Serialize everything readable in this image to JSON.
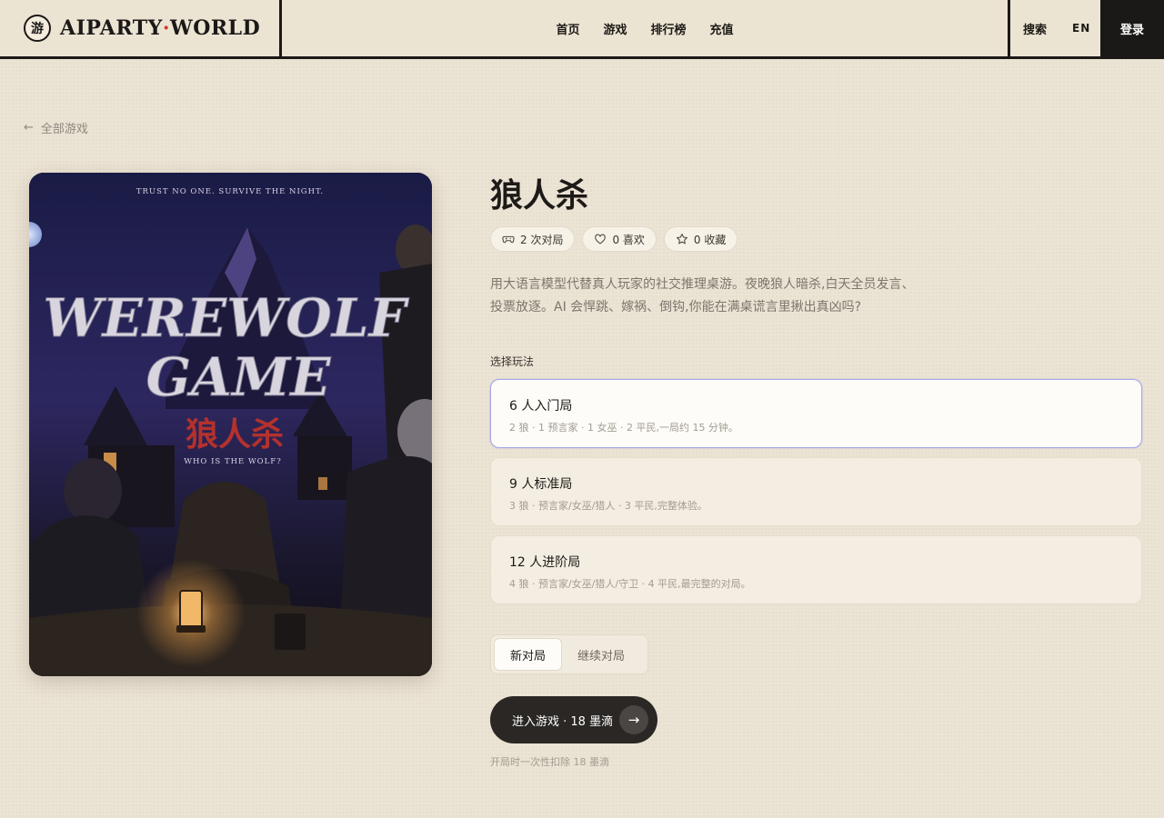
{
  "brand": {
    "logo_char": "游",
    "name_left": "AIPARTY",
    "name_dot": "·",
    "name_right": "WORLD"
  },
  "nav": {
    "items": [
      "首页",
      "游戏",
      "排行榜",
      "充值"
    ],
    "search": "搜索",
    "lang": "EN",
    "login": "登录"
  },
  "back": {
    "label": "全部游戏"
  },
  "poster": {
    "tagline_top": "TRUST NO ONE. SURVIVE THE NIGHT.",
    "title_line1": "WEREWOLF",
    "title_line2": "GAME",
    "title_cn": "狼人杀",
    "tagline_bottom": "WHO IS THE WOLF?"
  },
  "game": {
    "title": "狼人杀",
    "stats": {
      "plays": "2 次对局",
      "likes": "0 喜欢",
      "favorites": "0 收藏"
    },
    "description_line1": "用大语言模型代替真人玩家的社交推理桌游。夜晚狼人暗杀,白天全员发言、",
    "description_line2": "投票放逐。AI 会悍跳、嫁祸、倒钩,你能在满桌谎言里揪出真凶吗?"
  },
  "modes": {
    "label": "选择玩法",
    "items": [
      {
        "name": "6 人入门局",
        "desc": "2 狼 · 1 预言家 · 1 女巫 · 2 平民,一局约 15 分钟。",
        "selected": true
      },
      {
        "name": "9 人标准局",
        "desc": "3 狼 · 预言家/女巫/猎人 · 3 平民,完整体验。",
        "selected": false
      },
      {
        "name": "12 人进阶局",
        "desc": "4 狼 · 预言家/女巫/猎人/守卫 · 4 平民,最完整的对局。",
        "selected": false
      }
    ]
  },
  "tabs": {
    "new_game": "新对局",
    "continue_game": "继续对局",
    "active": "new_game"
  },
  "enter": {
    "label": "进入游戏 · 18 墨滴",
    "arrow": "→"
  },
  "cost_note": "开局时一次性扣除 18 墨滴",
  "colors": {
    "background": "#ebe3d4",
    "ink": "#1b1917",
    "accent_dot": "#d23a2a",
    "selected_border": "#a7a6e6"
  }
}
